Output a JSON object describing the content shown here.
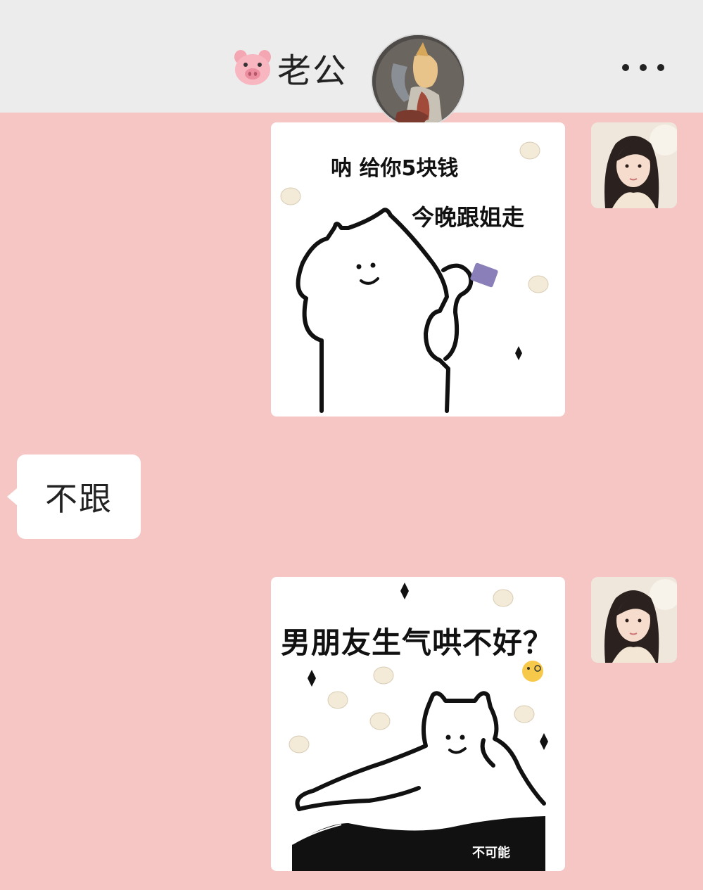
{
  "header": {
    "title": "老公",
    "title_emoji": "pig-face-icon",
    "more_icon": "more-dots-icon"
  },
  "messages": [
    {
      "sender": "me",
      "type": "sticker",
      "captions": [
        "呐 给你5块钱",
        "今晚跟姐走"
      ]
    },
    {
      "sender": "other",
      "type": "text",
      "text": "不跟"
    },
    {
      "sender": "me",
      "type": "sticker",
      "captions": [
        "男朋友生气哄不好？",
        "不可能"
      ]
    }
  ],
  "colors": {
    "background": "#f5c6c4",
    "header": "#ececec",
    "bubble": "#ffffff"
  }
}
